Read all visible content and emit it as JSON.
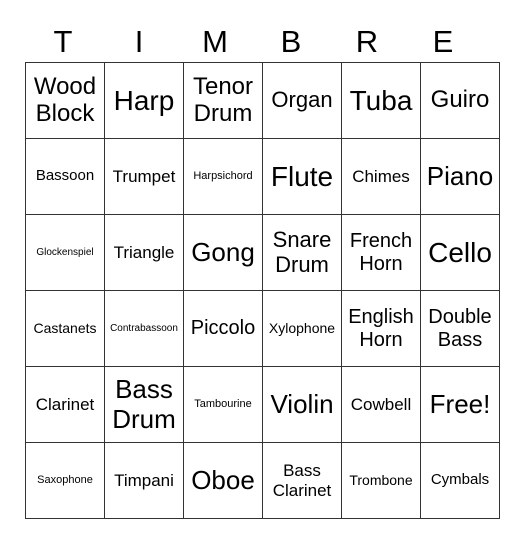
{
  "title_letters": [
    "T",
    "I",
    "M",
    "B",
    "R",
    "E"
  ],
  "rows": [
    [
      "Wood Block",
      "Harp",
      "Tenor Drum",
      "Organ",
      "Tuba",
      "Guiro"
    ],
    [
      "Bassoon",
      "Trumpet",
      "Harpsichord",
      "Flute",
      "Chimes",
      "Piano"
    ],
    [
      "Glockenspiel",
      "Triangle",
      "Gong",
      "Snare Drum",
      "French Horn",
      "Cello"
    ],
    [
      "Castanets",
      "Contrabassoon",
      "Piccolo",
      "Xylophone",
      "English Horn",
      "Double Bass"
    ],
    [
      "Clarinet",
      "Bass Drum",
      "Tambourine",
      "Violin",
      "Cowbell",
      "Free!"
    ],
    [
      "Saxophone",
      "Timpani",
      "Oboe",
      "Bass Clarinet",
      "Trombone",
      "Cymbals"
    ]
  ]
}
